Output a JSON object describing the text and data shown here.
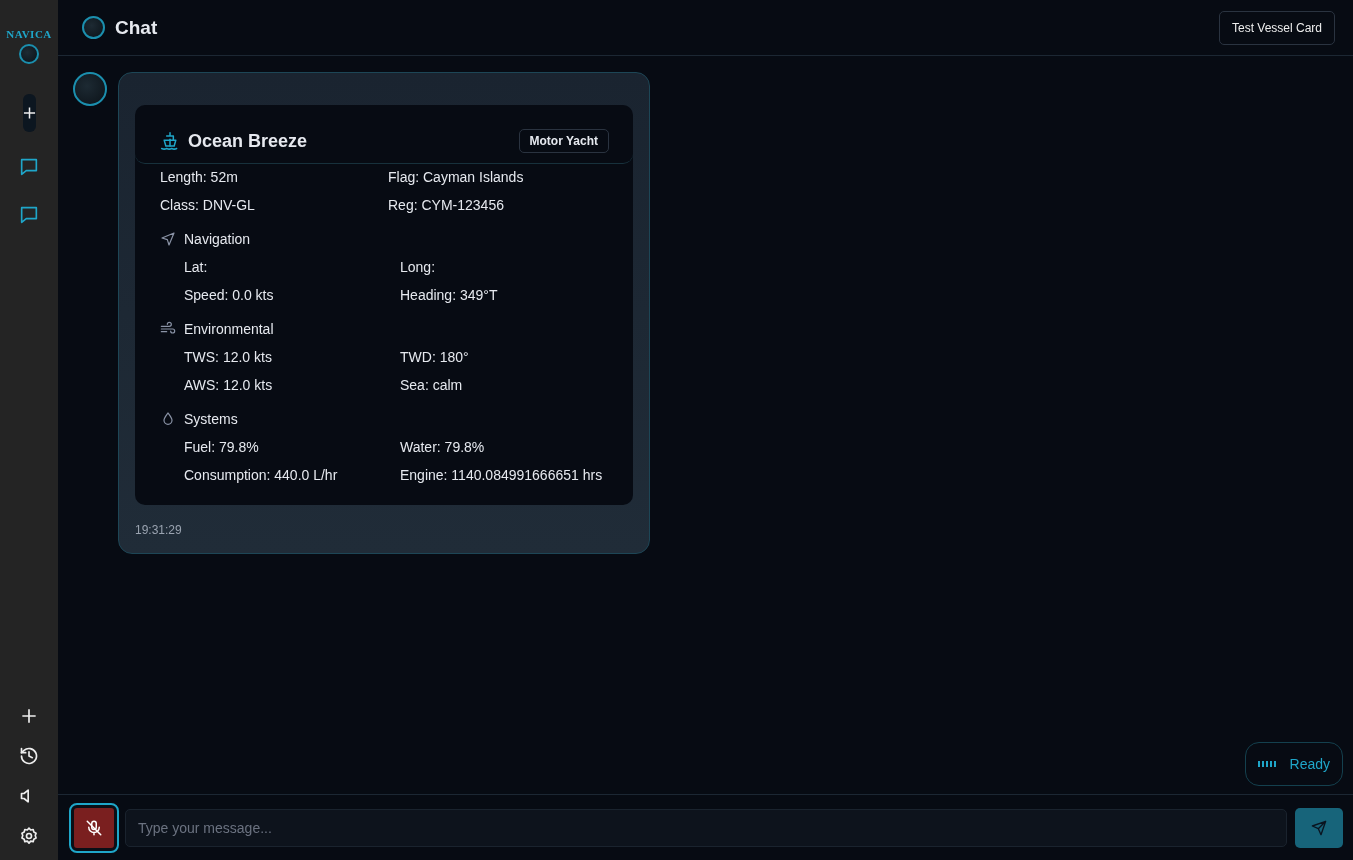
{
  "sidebar": {
    "logo": "NAVICA"
  },
  "header": {
    "title": "Chat",
    "button": "Test Vessel Card"
  },
  "message": {
    "time": "19:31:29",
    "vessel": {
      "name": "Ocean Breeze",
      "type": "Motor Yacht",
      "details": [
        "Length: 52m",
        "Flag: Cayman Islands",
        "Class: DNV-GL",
        "Reg: CYM-123456"
      ],
      "sections": [
        {
          "kind": "navigation",
          "title": "Navigation",
          "fields": [
            "Lat:",
            "Long:",
            "Speed: 0.0 kts",
            "Heading: 349°T"
          ]
        },
        {
          "kind": "environmental",
          "title": "Environmental",
          "fields": [
            "TWS: 12.0 kts",
            "TWD: 180°",
            "AWS: 12.0 kts",
            "Sea: calm"
          ]
        },
        {
          "kind": "systems",
          "title": "Systems",
          "fields": [
            "Fuel: 79.8%",
            "Water: 79.8%",
            "Consumption: 440.0 L/hr",
            "Engine: 1140.084991666651 hrs"
          ]
        }
      ]
    }
  },
  "status": "Ready",
  "composer": {
    "muted": true,
    "placeholder": "Type your message..."
  }
}
